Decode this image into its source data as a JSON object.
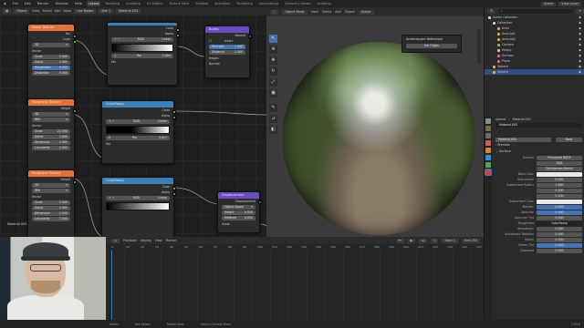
{
  "topbar": {
    "menus": [
      "File",
      "Edit",
      "Render",
      "Window",
      "Help"
    ],
    "workspaces": [
      "Layout",
      "Modeling",
      "Sculpting",
      "UV Editing",
      "Texture Paint",
      "Shading",
      "Animation",
      "Rendering",
      "Compositing",
      "Geometry Nodes",
      "Scripting"
    ],
    "active_workspace": "Layout",
    "scene": "Scene",
    "view_layer": "View Layer"
  },
  "node_editor": {
    "header": {
      "editor": "Object",
      "menus": [
        "View",
        "Select",
        "Add",
        "Node"
      ],
      "use_nodes": "Use Nodes",
      "slot": "Slot 1",
      "material": "Material.003"
    },
    "nodes": {
      "noise_texture": {
        "title": "Noise Texture",
        "fac": "Fac",
        "color": "Color",
        "dim": "3D",
        "type": "fBM",
        "vector": "Vector",
        "scale": "5.000",
        "scale_label": "Scale",
        "detail": "2.000",
        "detail_label": "Detail",
        "roughness": "0.500",
        "roughness_label": "Roughness",
        "distortion": "0.000",
        "distortion_label": "Distortion"
      },
      "colorramp_top": {
        "title": "",
        "color": "Color",
        "alpha": "Alpha",
        "mode": "RGB",
        "interp": "Linear",
        "pos": "1",
        "pos_label": "Pos",
        "value": "1.000",
        "fac": "Fac"
      },
      "bump": {
        "title": "Bump",
        "normal_out": "Normal",
        "invert": "Invert",
        "strength": "1.000",
        "strength_label": "Strength",
        "distance": "1.000",
        "distance_label": "Distance",
        "height": "Height",
        "normal": "Normal"
      },
      "musgrave_1": {
        "title": "Musgrave Texture",
        "height": "Height",
        "dim": "3D",
        "type": "fBM",
        "vector": "Vector",
        "scale": "22.000",
        "scale_label": "Scale",
        "detail": "2.000",
        "detail_label": "Detail",
        "dimension": "2.000",
        "dimension_label": "Dimension",
        "lacunarity": "2.000",
        "lacunarity_label": "Lacunarity"
      },
      "colorramp_mid": {
        "title": "ColorRamp",
        "color": "Color",
        "alpha": "Alpha",
        "mode": "RGB",
        "interp": "Linear",
        "pos_num": "0",
        "pos_label": "Pos",
        "value": "0.417",
        "fac": "Fac"
      },
      "musgrave_2": {
        "title": "Musgrave Texture",
        "height": "Height",
        "dim": "3D",
        "type": "fBM",
        "vector": "Vector",
        "scale": "5.000",
        "scale_label": "Scale",
        "detail": "2.000",
        "detail_label": "Detail",
        "dimension": "2.000",
        "dimension_label": "Dimension",
        "lacunarity": "2.000",
        "lacunarity_label": "Lacunarity"
      },
      "colorramp_bot": {
        "title": "ColorRamp",
        "color": "Color",
        "alpha": "Alpha",
        "mode": "RGB",
        "interp": "Linear"
      },
      "displacement": {
        "title": "Displacement",
        "output": "Displacement",
        "space": "Object Space",
        "height": "0.500",
        "height_label": "Height",
        "midlevel": "0.000",
        "midlevel_label": "Midlevel",
        "scale": "Scale"
      }
    },
    "material_label": "Material.003"
  },
  "viewport": {
    "mode": "Object Mode",
    "menus": [
      "View",
      "Select",
      "Add",
      "Object"
    ],
    "transform": "Global",
    "popup_title": "Screenspace Refraction",
    "popup_button": "Set Origin"
  },
  "outliner": {
    "search_placeholder": "",
    "items": [
      {
        "label": "Scene Collection",
        "indent": 0,
        "color": "#cfcfcf"
      },
      {
        "label": "Collection",
        "indent": 1,
        "color": "#cfcfcf"
      },
      {
        "label": "Area",
        "indent": 2,
        "color": "#e0b24a"
      },
      {
        "label": "Area.001",
        "indent": 2,
        "color": "#e0b24a"
      },
      {
        "label": "Area.002",
        "indent": 2,
        "color": "#e0b24a"
      },
      {
        "label": "Camera",
        "indent": 2,
        "color": "#9ab36a"
      },
      {
        "label": "Empty",
        "indent": 2,
        "color": "#cfcfcf"
      },
      {
        "label": "Surface",
        "indent": 2,
        "color": "#e36e6e"
      },
      {
        "label": "Plane",
        "indent": 2,
        "color": "#e36e6e"
      },
      {
        "label": "Sphere",
        "indent": 1,
        "color": "#e0b24a"
      },
      {
        "label": "Sphere",
        "indent": 1,
        "color": "#e0b24a"
      }
    ],
    "selected_index": 10
  },
  "properties": {
    "object": "Sphere",
    "material": "Material.003",
    "slot_label": "Material.003",
    "data_label": "Data",
    "preview": "Preview",
    "surface": "Surface",
    "surface_label": "Surface",
    "surface_value": "Principled BSDF",
    "distribution": "GGX",
    "subsurface_method": "Christensen-Burley",
    "rows": [
      {
        "label": "Base Color",
        "value": "",
        "style": "white"
      },
      {
        "label": "Subsurface",
        "value": "0.000",
        "style": ""
      },
      {
        "label": "Subsurface Radius",
        "value": "1.000",
        "style": ""
      },
      {
        "label": "",
        "value": "0.200",
        "style": ""
      },
      {
        "label": "",
        "value": "0.100",
        "style": ""
      },
      {
        "label": "Subsurface Color",
        "value": "",
        "style": "white"
      },
      {
        "label": "Metallic",
        "value": "0.000",
        "style": "blue"
      },
      {
        "label": "Specular",
        "value": "0.500",
        "style": "blue"
      },
      {
        "label": "Specular Tint",
        "value": "0.000",
        "style": ""
      },
      {
        "label": "Roughness",
        "value": "ColorRamp",
        "style": "dark"
      },
      {
        "label": "Anisotropic",
        "value": "0.000",
        "style": ""
      },
      {
        "label": "Anisotropic Rotation",
        "value": "0.000",
        "style": ""
      },
      {
        "label": "Sheen",
        "value": "0.000",
        "style": ""
      },
      {
        "label": "Sheen Tint",
        "value": "0.500",
        "style": "blue"
      },
      {
        "label": "Clearcoat",
        "value": "0.000",
        "style": ""
      }
    ]
  },
  "timeline": {
    "menus": [
      "Playback",
      "Keying",
      "View",
      "Marker"
    ],
    "current_frame": "1",
    "start_label": "Start",
    "start": "1",
    "end_label": "End",
    "end": "250",
    "ruler": [
      "0",
      "10",
      "20",
      "30",
      "40",
      "50",
      "60",
      "70",
      "80",
      "90",
      "100",
      "110",
      "120",
      "130",
      "140",
      "150",
      "160",
      "170",
      "180",
      "190",
      "200",
      "210",
      "220",
      "230",
      "240",
      "250"
    ]
  },
  "statusbar": {
    "items": [
      "Select",
      "Box Select",
      "Rotate View",
      "Object Context Menu"
    ],
    "version": "2.93.0"
  },
  "colors": {
    "accent": "#4772b3",
    "texture_node": "#e0733c",
    "converter_node": "#3c80b6",
    "vector_node": "#6a4cc2",
    "socket_yellow": "#c7c729",
    "socket_gray": "#a1a1a1",
    "socket_purple": "#6363c7"
  }
}
